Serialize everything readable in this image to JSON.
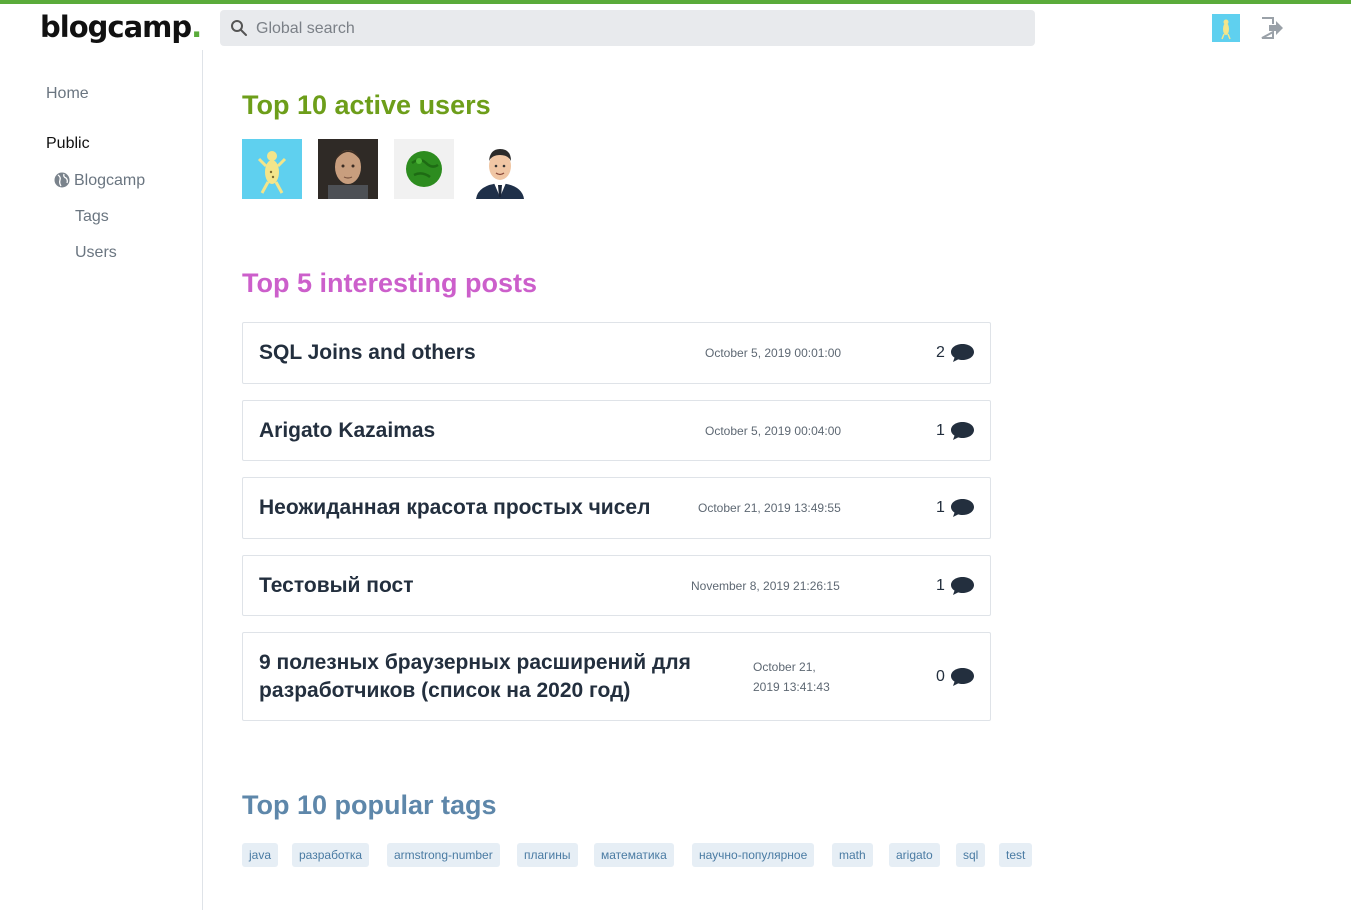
{
  "header": {
    "logo_text": "blogcamp",
    "logo_dot": ".",
    "search_placeholder": "Global search",
    "accent_color": "#5aab3a"
  },
  "sidebar": {
    "home": "Home",
    "public": "Public",
    "blogcamp": "Blogcamp",
    "tags": "Tags",
    "users": "Users"
  },
  "sections": {
    "users_title": "Top 10 active users",
    "posts_title": "Top 5 interesting posts",
    "tags_title": "Top 10 popular tags"
  },
  "posts": [
    {
      "title": "SQL Joins and others",
      "date": "October 5, 2019 00:01:00",
      "comments": "2"
    },
    {
      "title": "Arigato Kazaimas",
      "date": "October 5, 2019 00:04:00",
      "comments": "1"
    },
    {
      "title": "Неожиданная красота простых чисел",
      "date": "October 21, 2019 13:49:55",
      "comments": "1"
    },
    {
      "title": "Тестовый пост",
      "date": "November 8, 2019 21:26:15",
      "comments": "1"
    },
    {
      "title_line1": "9 полезных браузерных расширений для",
      "title_line2": "разработчиков (список на 2020 год)",
      "date_line1": "October 21,",
      "date_line2": "2019 13:41:43",
      "comments": "0"
    }
  ],
  "tags": [
    "java",
    "разработка",
    "armstrong-number",
    "плагины",
    "математика",
    "научно-популярное",
    "math",
    "arigato",
    "sql",
    "test"
  ],
  "colors": {
    "users_title": "#6d9e1a",
    "posts_title": "#cc5fcb",
    "tags_title": "#5e87aa"
  }
}
